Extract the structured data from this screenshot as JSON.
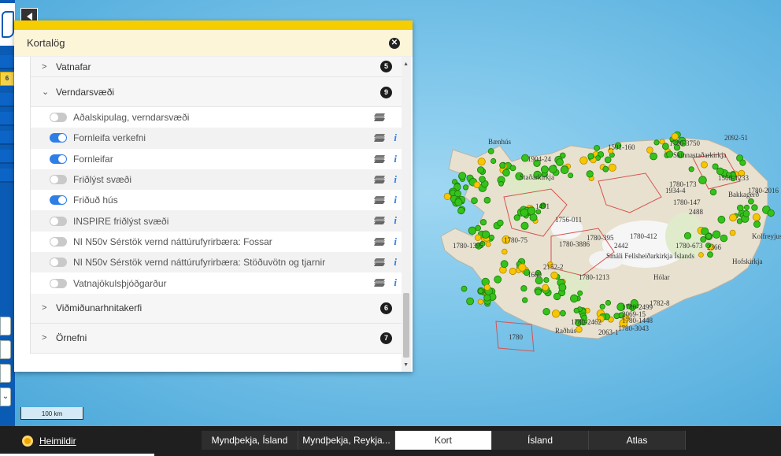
{
  "panel": {
    "title": "Kortalög",
    "groups": [
      {
        "name": "Vatnafar",
        "count": "5",
        "expanded": false
      },
      {
        "name": "Verndarsvæði",
        "count": "9",
        "expanded": true,
        "layers": [
          {
            "name": "Aðalskipulag, verndarsvæði",
            "on": false,
            "info": false
          },
          {
            "name": "Fornleifa verkefni",
            "on": true,
            "info": true
          },
          {
            "name": "Fornleifar",
            "on": true,
            "info": true
          },
          {
            "name": "Friðlýst svæði",
            "on": false,
            "info": true
          },
          {
            "name": "Friðuð hús",
            "on": true,
            "info": true
          },
          {
            "name": "INSPIRE friðlýst svæði",
            "on": false,
            "info": true
          },
          {
            "name": "NI N50v Sérstök vernd náttúrufyrirbæra: Fossar",
            "on": false,
            "info": true
          },
          {
            "name": "NI N50v Sérstök vernd náttúrufyrirbæra: Stöðuvötn og tjarnir",
            "on": false,
            "info": true
          },
          {
            "name": "Vatnajökulsþjóðgarður",
            "on": false,
            "info": true
          }
        ]
      },
      {
        "name": "Viðmiðunarhnitakerfi",
        "count": "6",
        "expanded": false
      },
      {
        "name": "Örnefni",
        "count": "7",
        "expanded": false
      }
    ]
  },
  "left_badge": "6",
  "scale_label": "100 km",
  "heimildir": "Heimildir",
  "basemaps": [
    {
      "label": "Myndþekja, Ísland",
      "active": false
    },
    {
      "label": "Myndþekja, Reykja...",
      "active": false
    },
    {
      "label": "Kort",
      "active": true
    },
    {
      "label": "Ísland",
      "active": false
    },
    {
      "label": "Atlas",
      "active": false
    }
  ],
  "map_labels": [
    "Bænhús",
    "Skinnastaðarkirkja",
    "1780-3750",
    "2092-51",
    "Bakkagerð",
    "1780-2016",
    "Kolfreyjus",
    "1501-160",
    "1780-412",
    "Smáli Fellsheiðarkirkja Íslands",
    "Hólar",
    "2442",
    "1780-395",
    "1780-673",
    "2366",
    "Hofskirkja",
    "1780-2499",
    "2069-15",
    "1780-1448",
    "Raðhús",
    "2063-1",
    "1780-3043",
    "1780",
    "1560-1233",
    "1934-4",
    "1780-173",
    "2488",
    "1780-147",
    "1904-24",
    "Staðarkirkja",
    "1780-1213",
    "1780-2462",
    "1780-3886",
    "1756-011",
    "1491",
    "1669",
    "1780-75",
    "1780-1395",
    "2152-2",
    "1782-8"
  ],
  "colors": {
    "accent": "#f6cd00",
    "toggle_on": "#2f7ee6",
    "info": "#2f7ee6",
    "marker_green": "#35c21b",
    "marker_yellow": "#f7c600",
    "outline_red": "#d6534f"
  }
}
